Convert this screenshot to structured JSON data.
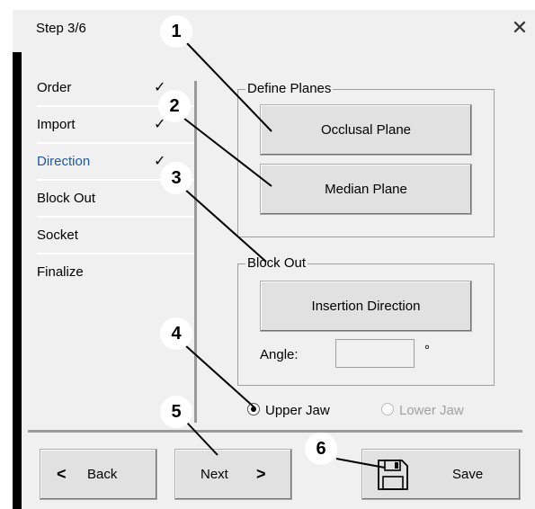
{
  "window": {
    "title": "Step 3/6",
    "close_glyph": "✕"
  },
  "nav": {
    "items": [
      {
        "label": "Order",
        "check": "✓"
      },
      {
        "label": "Import",
        "check": "✓"
      },
      {
        "label": "Direction",
        "check": "✓"
      },
      {
        "label": "Block Out",
        "check": ""
      },
      {
        "label": "Socket",
        "check": ""
      },
      {
        "label": "Finalize",
        "check": ""
      }
    ],
    "active": "Direction"
  },
  "define_planes": {
    "legend": "Define Planes",
    "occlusal_label": "Occlusal Plane",
    "median_label": "Median Plane"
  },
  "block_out": {
    "legend": "Block Out",
    "insertion_label": "Insertion Direction",
    "angle_label": "Angle:",
    "angle_value": "",
    "degree_symbol": "°"
  },
  "jaw": {
    "upper_label": "Upper Jaw",
    "lower_label": "Lower Jaw",
    "selected": "Upper Jaw",
    "lower_enabled": false
  },
  "footer": {
    "back_label": "Back",
    "next_label": "Next",
    "save_label": "Save",
    "back_glyph": "<",
    "next_glyph": ">"
  },
  "callouts": [
    "1",
    "2",
    "3",
    "4",
    "5",
    "6"
  ],
  "icons": {
    "save": "floppy-disk-icon"
  },
  "colors": {
    "active_nav": "#1e5a9c",
    "window_bg": "#f0f0f0",
    "button_bg": "#e1e1e1"
  }
}
